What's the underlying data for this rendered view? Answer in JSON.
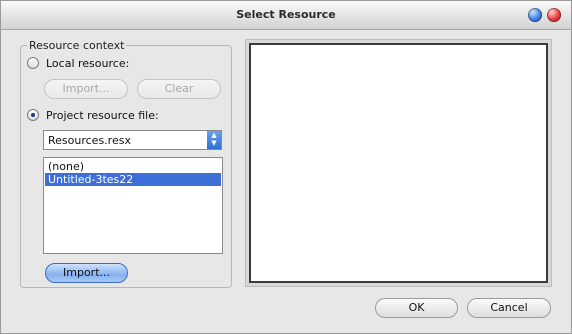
{
  "window": {
    "title": "Select Resource",
    "minimize_symbol": "",
    "close_symbol": ""
  },
  "resource_context": {
    "group_label": "Resource context",
    "local_resource": {
      "label": "Local resource:",
      "selected": false,
      "import_label": "Import...",
      "clear_label": "Clear"
    },
    "project_resource": {
      "label": "Project resource file:",
      "selected": true,
      "file_select_value": "Resources.resx",
      "list_items": [
        {
          "label": "(none)",
          "selected": false
        },
        {
          "label": "Untitled-3tes22",
          "selected": true
        }
      ],
      "import_label": "Import..."
    }
  },
  "buttons": {
    "ok_label": "OK",
    "cancel_label": "Cancel"
  },
  "icons": {
    "select_arrows": "updown-arrows-icon"
  }
}
